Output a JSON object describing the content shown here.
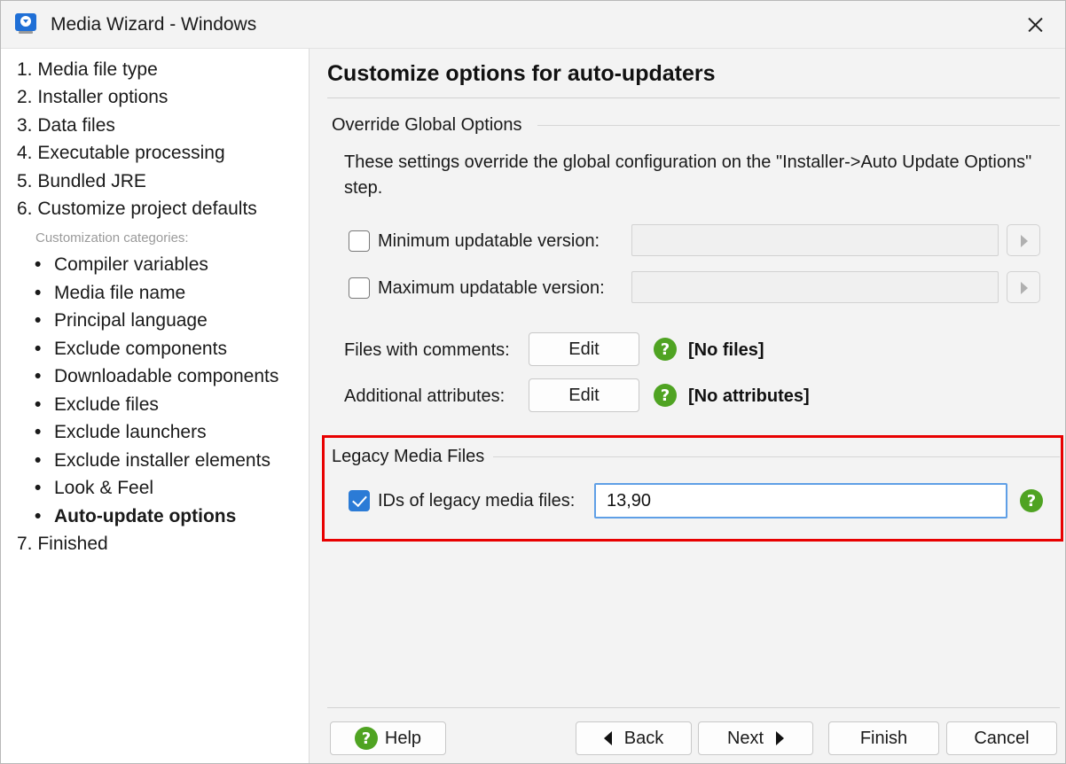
{
  "window": {
    "title": "Media Wizard - Windows"
  },
  "sidebar": {
    "steps": [
      {
        "label": "1. Media file type"
      },
      {
        "label": "2. Installer options"
      },
      {
        "label": "3. Data files"
      },
      {
        "label": "4. Executable processing"
      },
      {
        "label": "5. Bundled JRE"
      },
      {
        "label": "6. Customize project defaults"
      }
    ],
    "categories_label": "Customization categories:",
    "categories": [
      {
        "label": "Compiler variables"
      },
      {
        "label": "Media file name"
      },
      {
        "label": "Principal language"
      },
      {
        "label": "Exclude components"
      },
      {
        "label": "Downloadable components"
      },
      {
        "label": "Exclude files"
      },
      {
        "label": "Exclude launchers"
      },
      {
        "label": "Exclude installer elements"
      },
      {
        "label": "Look & Feel"
      },
      {
        "label": "Auto-update options",
        "active": true
      }
    ],
    "final_step": "7. Finished",
    "bullet": "•"
  },
  "main": {
    "heading": "Customize options for auto-updaters",
    "override_group": {
      "title": "Override Global Options",
      "description": "These settings override the global configuration on the \"Installer->Auto Update Options\" step.",
      "min_version": {
        "label": "Minimum updatable version:",
        "checked": false,
        "value": ""
      },
      "max_version": {
        "label": "Maximum updatable version:",
        "checked": false,
        "value": ""
      },
      "files_with_comments": {
        "label": "Files with comments:",
        "button": "Edit",
        "help": "?",
        "value": "[No files]"
      },
      "additional_attributes": {
        "label": "Additional attributes:",
        "button": "Edit",
        "help": "?",
        "value": "[No attributes]"
      }
    },
    "legacy_group": {
      "title": "Legacy Media Files",
      "ids": {
        "label": "IDs of legacy media files:",
        "checked": true,
        "value": "13,90",
        "help": "?"
      }
    }
  },
  "footer": {
    "help": "Help",
    "help_icon": "?",
    "back": "Back",
    "next": "Next",
    "finish": "Finish",
    "cancel": "Cancel"
  },
  "colors": {
    "accent": "#2b7bd6",
    "help_green": "#4fa322",
    "highlight": "#e80000"
  }
}
